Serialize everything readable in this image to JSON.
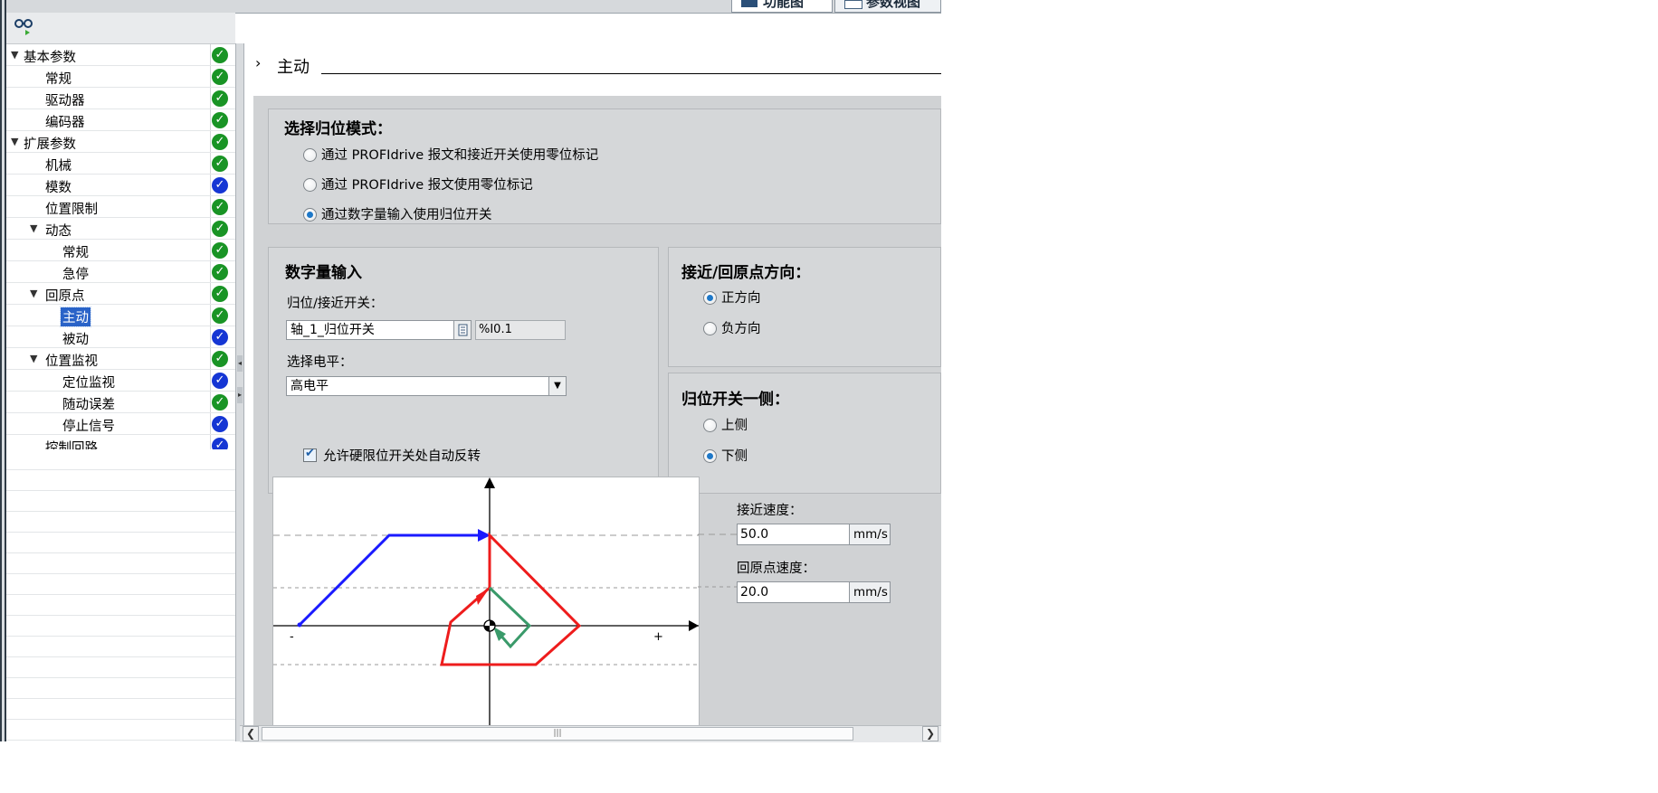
{
  "view_tabs": [
    {
      "label": "功能图",
      "active": true,
      "icon": "function-view-icon"
    },
    {
      "label": "参数视图",
      "active": false,
      "icon": "table-view-icon"
    }
  ],
  "toolbar": {
    "icon": "glasses-icon"
  },
  "tree": {
    "items": [
      {
        "label": "基本参数",
        "level": 0,
        "expanded": true,
        "status": "ok"
      },
      {
        "label": "常规",
        "level": 1,
        "status": "ok"
      },
      {
        "label": "驱动器",
        "level": 1,
        "status": "ok"
      },
      {
        "label": "编码器",
        "level": 1,
        "status": "ok"
      },
      {
        "label": "扩展参数",
        "level": 0,
        "expanded": true,
        "status": "ok"
      },
      {
        "label": "机械",
        "level": 1,
        "status": "ok"
      },
      {
        "label": "模数",
        "level": 1,
        "status": "info"
      },
      {
        "label": "位置限制",
        "level": 1,
        "status": "ok"
      },
      {
        "label": "动态",
        "level": 1,
        "expanded": true,
        "status": "ok"
      },
      {
        "label": "常规",
        "level": 2,
        "status": "ok"
      },
      {
        "label": "急停",
        "level": 2,
        "status": "ok"
      },
      {
        "label": "回原点",
        "level": 1,
        "expanded": true,
        "status": "ok"
      },
      {
        "label": "主动",
        "level": 2,
        "status": "ok",
        "selected": true
      },
      {
        "label": "被动",
        "level": 2,
        "status": "info"
      },
      {
        "label": "位置监视",
        "level": 1,
        "expanded": true,
        "status": "ok"
      },
      {
        "label": "定位监视",
        "level": 2,
        "status": "info"
      },
      {
        "label": "随动误差",
        "level": 2,
        "status": "ok"
      },
      {
        "label": "停止信号",
        "level": 2,
        "status": "info"
      },
      {
        "label": "控制回路",
        "level": 1,
        "status": "info"
      }
    ],
    "status_colors": {
      "ok": "#199425",
      "info": "#1536d4"
    }
  },
  "section": {
    "chevron": "›",
    "title": "主动"
  },
  "homing_mode": {
    "title": "选择归位模式：",
    "options": [
      {
        "label": "通过 PROFIdrive 报文和接近开关使用零位标记",
        "selected": false
      },
      {
        "label": "通过 PROFIdrive 报文使用零位标记",
        "selected": false
      },
      {
        "label": "通过数字量输入使用归位开关",
        "selected": true
      }
    ]
  },
  "digital_input": {
    "title": "数字量输入",
    "switch_label": "归位/接近开关：",
    "switch_value": "轴_1_归位开关",
    "address": "%I0.1",
    "level_label": "选择电平：",
    "level_value": "高电平",
    "auto_reverse_label": "允许硬限位开关处自动反转",
    "auto_reverse_checked": true
  },
  "direction": {
    "title": "接近/回原点方向：",
    "options": [
      {
        "label": "正方向",
        "selected": true
      },
      {
        "label": "负方向",
        "selected": false
      }
    ]
  },
  "switch_side": {
    "title": "归位开关一侧：",
    "options": [
      {
        "label": "上侧",
        "selected": false
      },
      {
        "label": "下侧",
        "selected": true
      }
    ]
  },
  "diagram": {
    "minus_label": "-",
    "plus_label": "+"
  },
  "speeds": {
    "approach_label": "接近速度：",
    "approach_value": "50.0",
    "approach_unit": "mm/s",
    "homing_label": "回原点速度：",
    "homing_value": "20.0",
    "homing_unit": "mm/s"
  },
  "colors": {
    "accent": "#2a63c8",
    "panel": "#d0d2d4",
    "approach": "#1a1aff",
    "reverse": "#ee1c1c",
    "homing": "#3a9a6a"
  }
}
